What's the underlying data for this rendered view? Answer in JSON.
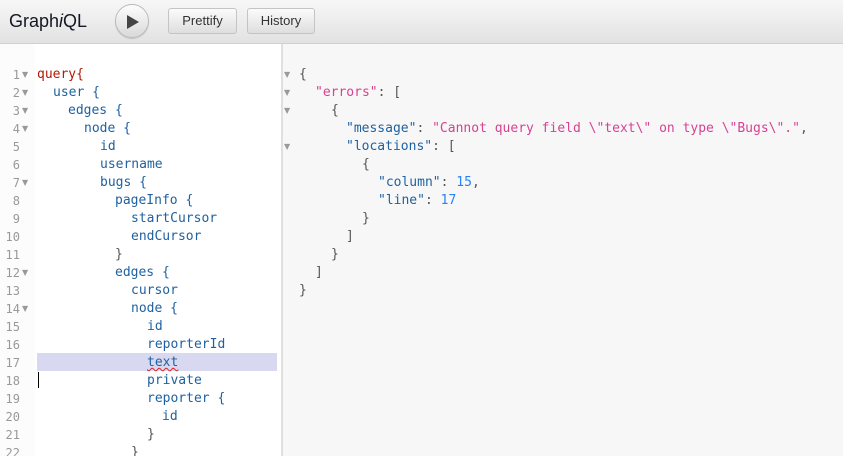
{
  "toolbar": {
    "title_a": "Graph",
    "title_b": "i",
    "title_c": "QL",
    "prettify_label": "Prettify",
    "history_label": "History"
  },
  "editor": {
    "lines": [
      {
        "n": "1",
        "t": "query{"
      },
      {
        "n": "2",
        "t": "user {"
      },
      {
        "n": "3",
        "t": "edges {"
      },
      {
        "n": "4",
        "t": "node {"
      },
      {
        "n": "5",
        "t": "id"
      },
      {
        "n": "6",
        "t": "username"
      },
      {
        "n": "7",
        "t": "bugs {"
      },
      {
        "n": "8",
        "t": "pageInfo {"
      },
      {
        "n": "9",
        "t": "startCursor"
      },
      {
        "n": "10",
        "t": "endCursor"
      },
      {
        "n": "11",
        "t": "}"
      },
      {
        "n": "12",
        "t": "edges {"
      },
      {
        "n": "13",
        "t": "cursor"
      },
      {
        "n": "14",
        "t": "node {"
      },
      {
        "n": "15",
        "t": "id"
      },
      {
        "n": "16",
        "t": "reporterId"
      },
      {
        "n": "17",
        "t": "text"
      },
      {
        "n": "18",
        "t": "private"
      },
      {
        "n": "19",
        "t": "reporter {"
      },
      {
        "n": "20",
        "t": "id"
      },
      {
        "n": "21",
        "t": "}"
      },
      {
        "n": "22",
        "t": "}"
      }
    ]
  },
  "result": {
    "l1": "{",
    "errors_key": "\"errors\"",
    "l2_rest": ": [",
    "l3": "{",
    "message_key": "\"message\"",
    "message_value": "\"Cannot query field \\\"text\\\" on type \\\"Bugs\\\".\"",
    "locations_key": "\"locations\"",
    "l5_rest": ": [",
    "l6": "{",
    "column_key": "\"column\"",
    "column_value": "15",
    "line_key": "\"line\"",
    "line_value": "17",
    "l9": "}",
    "l10": "]",
    "l11": "}",
    "l12": "]",
    "l13": "}"
  }
}
